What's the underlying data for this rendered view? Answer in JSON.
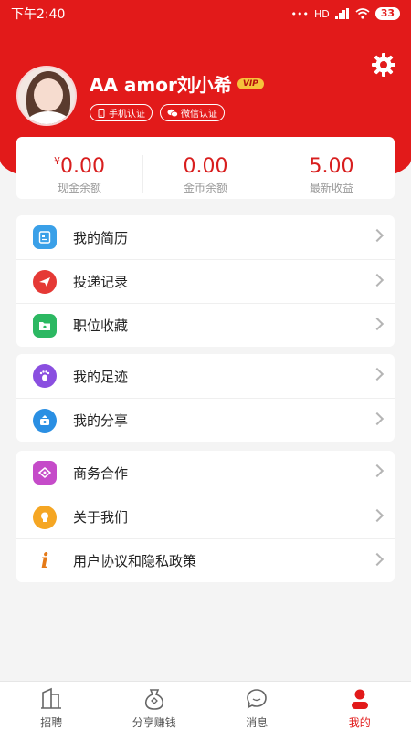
{
  "colors": {
    "brand": "#e21a1a",
    "accent_value": "#d81e1e"
  },
  "status_bar": {
    "time": "下午2:40",
    "network": "HD",
    "battery": "33"
  },
  "profile": {
    "username": "AA amor刘小希",
    "vip": "VIP",
    "badges": [
      {
        "label": "手机认证",
        "icon": "phone-icon"
      },
      {
        "label": "微信认证",
        "icon": "wechat-icon"
      }
    ]
  },
  "balances": [
    {
      "currency": "¥",
      "value": "0.00",
      "label": "现金余额"
    },
    {
      "currency": "",
      "value": "0.00",
      "label": "金币余额"
    },
    {
      "currency": "",
      "value": "5.00",
      "label": "最新收益"
    }
  ],
  "menu_groups": [
    [
      {
        "label": "我的简历",
        "icon": "resume-icon",
        "color": "#3aa0e8"
      },
      {
        "label": "投递记录",
        "icon": "paper-plane-icon",
        "color": "#e53935"
      },
      {
        "label": "职位收藏",
        "icon": "favorite-folder-icon",
        "color": "#2cb862"
      }
    ],
    [
      {
        "label": "我的足迹",
        "icon": "footprint-icon",
        "color": "#8a4fe0"
      },
      {
        "label": "我的分享",
        "icon": "share-icon",
        "color": "#2a8fe3"
      }
    ],
    [
      {
        "label": "商务合作",
        "icon": "handshake-icon",
        "color": "#c54bc9"
      },
      {
        "label": "关于我们",
        "icon": "lightbulb-icon",
        "color": "#f5a623"
      },
      {
        "label": "用户协议和隐私政策",
        "icon": "info-icon",
        "color": "#e57a18"
      }
    ]
  ],
  "tabbar": [
    {
      "label": "招聘",
      "icon": "building-icon",
      "active": false
    },
    {
      "label": "分享赚钱",
      "icon": "money-bag-icon",
      "active": false
    },
    {
      "label": "消息",
      "icon": "chat-bubble-icon",
      "active": false
    },
    {
      "label": "我的",
      "icon": "user-icon",
      "active": true
    }
  ]
}
